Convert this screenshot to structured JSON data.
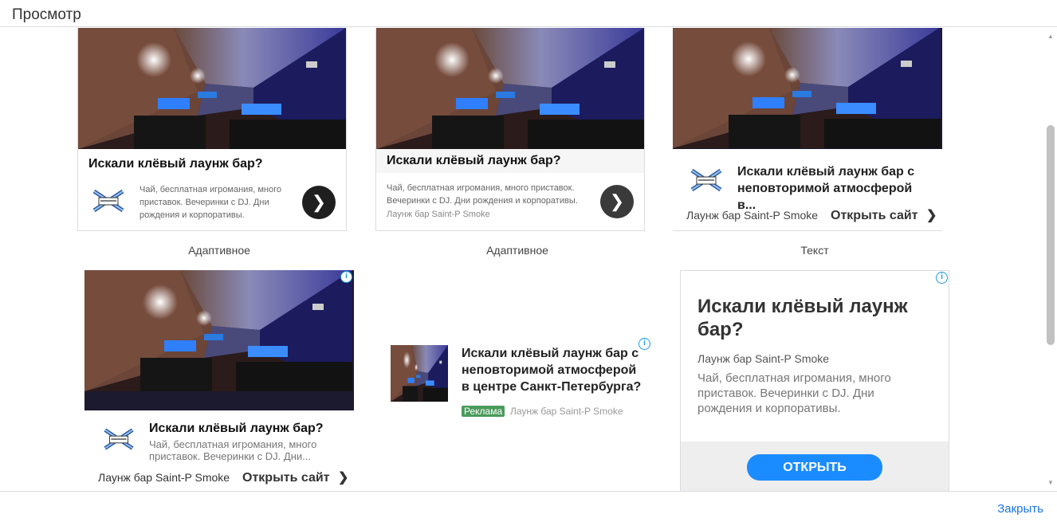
{
  "window": {
    "title": "Просмотр",
    "close_label": "Закрыть"
  },
  "ad": {
    "headline_short": "Искали клёвый лаунж бар?",
    "headline_long": "Искали клёвый лаунж бар с неповторимой атмосферой в...",
    "headline_full": "Искали клёвый лаунж бар с неповторимой атмосферой в центре Санкт-Петербурга?",
    "description": "Чай, бесплатная игромания, много приставок. Вечеринки с DJ. Дни рождения и корпоративы.",
    "description_truncated": "Чай, бесплатная игромания, много приставок. Вечеринки с DJ. Дни...",
    "advertiser": "Лаунж бар Saint-P Smoke",
    "open_site": "Открыть сайт",
    "open_button": "ОТКРЫТЬ",
    "ad_badge": "Реклама",
    "headline_big": "Искали клёвый лаунж бар?"
  },
  "labels": {
    "adaptive": "Адаптивное",
    "text": "Текст"
  },
  "colors": {
    "accent": "#1a73e8",
    "open_button": "#1a8cff",
    "badge": "#4a9b5c",
    "info": "#1a9be6"
  },
  "icons": {
    "arrow": "chevron-right-icon",
    "info": "info-icon",
    "logo": "brand-logo"
  }
}
